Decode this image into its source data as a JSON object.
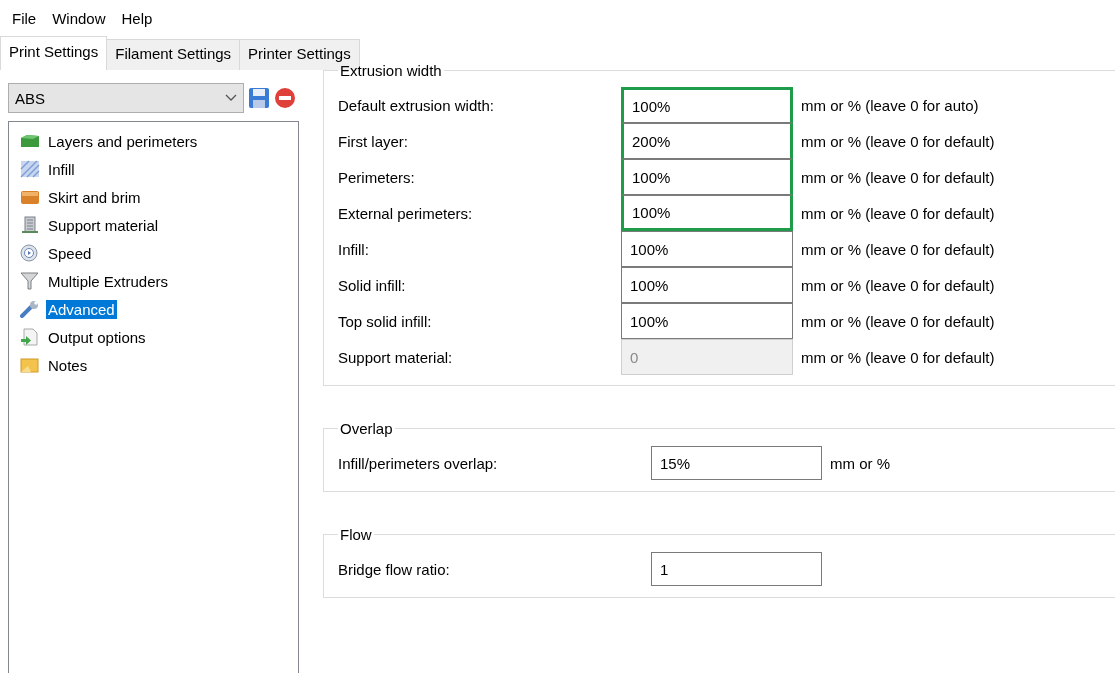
{
  "menu": [
    "File",
    "Window",
    "Help"
  ],
  "tabs": [
    {
      "label": "Print Settings",
      "selected": true
    },
    {
      "label": "Filament Settings",
      "selected": false
    },
    {
      "label": "Printer Settings",
      "selected": false
    }
  ],
  "preset": {
    "value": "ABS"
  },
  "sidebar": {
    "items": [
      {
        "label": "Layers and perimeters",
        "selected": false
      },
      {
        "label": "Infill",
        "selected": false
      },
      {
        "label": "Skirt and brim",
        "selected": false
      },
      {
        "label": "Support material",
        "selected": false
      },
      {
        "label": "Speed",
        "selected": false
      },
      {
        "label": "Multiple Extruders",
        "selected": false
      },
      {
        "label": "Advanced",
        "selected": true
      },
      {
        "label": "Output options",
        "selected": false
      },
      {
        "label": "Notes",
        "selected": false
      }
    ]
  },
  "groups": [
    {
      "title": "Extrusion width",
      "rows": [
        {
          "label": "Default extrusion width:",
          "value": "100%",
          "hint": "mm or % (leave 0 for auto)",
          "highlighted": true,
          "disabled": false
        },
        {
          "label": "First layer:",
          "value": "200%",
          "hint": "mm or % (leave 0 for default)",
          "highlighted": true,
          "disabled": false
        },
        {
          "label": "Perimeters:",
          "value": "100%",
          "hint": "mm or % (leave 0 for default)",
          "highlighted": true,
          "disabled": false
        },
        {
          "label": "External perimeters:",
          "value": "100%",
          "hint": "mm or % (leave 0 for default)",
          "highlighted": true,
          "disabled": false
        },
        {
          "label": "Infill:",
          "value": "100%",
          "hint": "mm or % (leave 0 for default)",
          "highlighted": false,
          "disabled": false
        },
        {
          "label": "Solid infill:",
          "value": "100%",
          "hint": "mm or % (leave 0 for default)",
          "highlighted": false,
          "disabled": false
        },
        {
          "label": "Top solid infill:",
          "value": "100%",
          "hint": "mm or % (leave 0 for default)",
          "highlighted": false,
          "disabled": false
        },
        {
          "label": "Support material:",
          "value": "0",
          "hint": "mm or % (leave 0 for default)",
          "highlighted": false,
          "disabled": true
        }
      ]
    },
    {
      "title": "Overlap",
      "rows": [
        {
          "label": "Infill/perimeters overlap:",
          "value": "15%",
          "hint": "mm or %",
          "highlighted": false,
          "disabled": false
        }
      ]
    },
    {
      "title": "Flow",
      "rows": [
        {
          "label": "Bridge flow ratio:",
          "value": "1",
          "highlighted": false,
          "disabled": false
        }
      ]
    }
  ]
}
